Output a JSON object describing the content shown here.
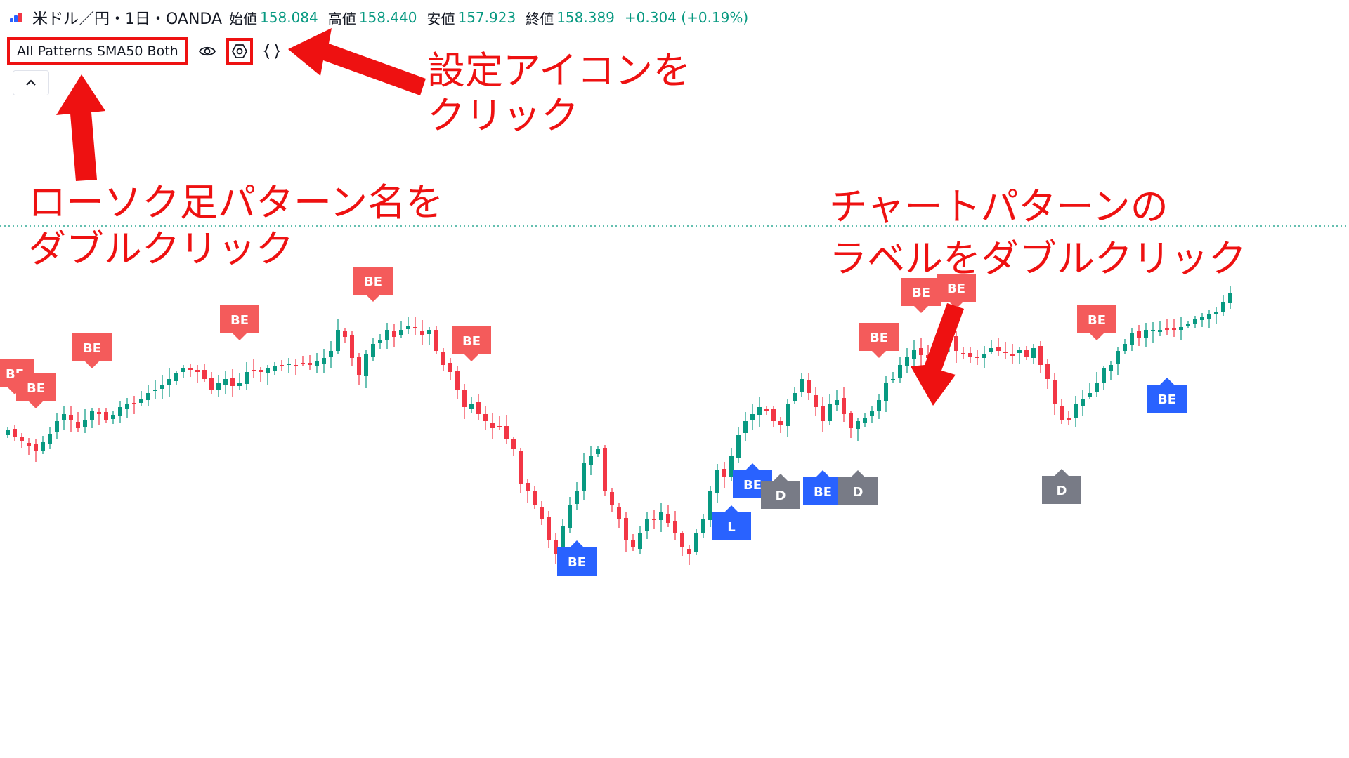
{
  "legend": {
    "symbol": "米ドル／円・1日・OANDA",
    "open_label": "始値",
    "open": "158.084",
    "high_label": "高値",
    "high": "158.440",
    "low_label": "安値",
    "low": "157.923",
    "close_label": "終値",
    "close": "158.389",
    "change": "+0.304 (+0.19%)"
  },
  "indicator": {
    "name": "All Patterns SMA50 Both",
    "tools": [
      "eye-icon",
      "gear-icon",
      "braces-icon",
      "trash-icon",
      "more-icon"
    ]
  },
  "annotations": {
    "settings_line1": "設定アイコンを",
    "settings_line2": "クリック",
    "candle_line1": "ローソク足パターン名を",
    "candle_line2": "ダブルクリック",
    "chart_line1": "チャートパターンの",
    "chart_line2": "ラベルをダブルクリック"
  },
  "colors": {
    "up": "#089981",
    "down": "#f23645",
    "bear_label": "#f45b5b",
    "bull_label": "#2962ff",
    "neutral_label": "#787b86",
    "annotation": "#ee1111"
  },
  "chart_data": {
    "type": "candlestick",
    "price_line_label": "",
    "closes": [
      612,
      622,
      628,
      635,
      642,
      630,
      618,
      600,
      590,
      598,
      610,
      598,
      585,
      590,
      598,
      592,
      580,
      576,
      574,
      568,
      560,
      555,
      548,
      540,
      532,
      525,
      525,
      530,
      540,
      555,
      545,
      540,
      550,
      545,
      530,
      528,
      530,
      525,
      522,
      520,
      518,
      520,
      518,
      520,
      515,
      510,
      500,
      470,
      480,
      510,
      535,
      505,
      490,
      485,
      470,
      480,
      470,
      465,
      468,
      478,
      470,
      500,
      520,
      530,
      555,
      580,
      575,
      590,
      600,
      610,
      608,
      625,
      640,
      690,
      700,
      720,
      740,
      770,
      790,
      750,
      720,
      700,
      660,
      650,
      640,
      700,
      720,
      740,
      770,
      780,
      760,
      740,
      740,
      730,
      745,
      760,
      780,
      790,
      760,
      740,
      700,
      670,
      680,
      650,
      620,
      600,
      590,
      580,
      585,
      600,
      605,
      575,
      560,
      540,
      560,
      580,
      600,
      575,
      570,
      590,
      610,
      600,
      595,
      585,
      570,
      545,
      540,
      520,
      508,
      498,
      506,
      510,
      495,
      488,
      478,
      500,
      505,
      508,
      508,
      504,
      496,
      500,
      502,
      505,
      498,
      508,
      496,
      520,
      540,
      575,
      598,
      596,
      576,
      568,
      560,
      545,
      525,
      520,
      500,
      490,
      475,
      482,
      470,
      470,
      470,
      468,
      468,
      466,
      462,
      455,
      452,
      448,
      445,
      430,
      418
    ],
    "labels": [
      {
        "kind": "bear",
        "text": "BE",
        "index": 1
      },
      {
        "kind": "bear",
        "text": "BE",
        "index": 4
      },
      {
        "kind": "bear",
        "text": "BE",
        "index": 12
      },
      {
        "kind": "bear",
        "text": "BE",
        "index": 33
      },
      {
        "kind": "bear",
        "text": "BE",
        "index": 52
      },
      {
        "kind": "bear",
        "text": "BE",
        "index": 66
      },
      {
        "kind": "bull",
        "text": "BE",
        "index": 81
      },
      {
        "kind": "bull",
        "text": "BE",
        "index": 106
      },
      {
        "kind": "bull",
        "text": "L",
        "index": 103
      },
      {
        "kind": "neutral",
        "text": "D",
        "index": 110
      },
      {
        "kind": "bull",
        "text": "BE",
        "index": 116
      },
      {
        "kind": "neutral",
        "text": "D",
        "index": 121
      },
      {
        "kind": "bear",
        "text": "BE",
        "index": 124
      },
      {
        "kind": "bear",
        "text": "BE",
        "index": 130
      },
      {
        "kind": "bear",
        "text": "BE",
        "index": 135
      },
      {
        "kind": "bear",
        "text": "BE",
        "index": 155
      },
      {
        "kind": "neutral",
        "text": "D",
        "index": 150
      },
      {
        "kind": "bull",
        "text": "BE",
        "index": 165
      },
      {
        "kind": "bear",
        "text": "BE",
        "index": 185
      }
    ]
  }
}
